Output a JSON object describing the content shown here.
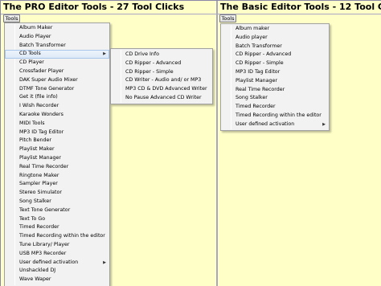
{
  "left": {
    "title": "The PRO Editor Tools - 27 Tool Clicks",
    "tools_label": "Tools",
    "menu": [
      {
        "label": "Album Maker"
      },
      {
        "label": "Audio Player"
      },
      {
        "label": "Batch Transformer"
      },
      {
        "label": "CD Tools",
        "submenu": true,
        "highlight": true
      },
      {
        "label": "CD Player"
      },
      {
        "label": "Crossfader Player"
      },
      {
        "label": "DAK Super Audio Mixer"
      },
      {
        "label": "DTMF Tone Generator"
      },
      {
        "label": "Get it (file info)"
      },
      {
        "label": "I Wish Recorder"
      },
      {
        "label": "Karaoke Wonders"
      },
      {
        "label": "MIDI Tools"
      },
      {
        "label": "MP3 ID Tag Editor"
      },
      {
        "label": "Pitch Bender"
      },
      {
        "label": "Playlist Maker"
      },
      {
        "label": "Playlist Manager"
      },
      {
        "label": "Real Time Recorder"
      },
      {
        "label": "Ringtone Maker"
      },
      {
        "label": "Sampler Player"
      },
      {
        "label": "Stereo Simulator"
      },
      {
        "label": "Song Stalker"
      },
      {
        "label": "Text Tone Generator"
      },
      {
        "label": "Text To Go"
      },
      {
        "label": "Timed Recorder"
      },
      {
        "label": "Timed Recording within the editor"
      },
      {
        "label": "Tune Library/ Player"
      },
      {
        "label": "USB MP3 Recorder"
      },
      {
        "label": "User defined activation",
        "submenu": true
      },
      {
        "label": "Unshackled DJ"
      },
      {
        "label": "Wave Waper"
      }
    ],
    "submenu": [
      {
        "label": "CD Drive Info"
      },
      {
        "label": "CD Ripper - Advanced"
      },
      {
        "label": "CD Ripper - Simple"
      },
      {
        "label": "CD Writer - Audio and/ or MP3"
      },
      {
        "label": "MP3 CD & DVD Advanced Writer"
      },
      {
        "label": "No Pause Advanced CD Writer"
      }
    ]
  },
  "right": {
    "title": "The Basic Editor Tools - 12 Tool Clicks",
    "tools_label": "Tools",
    "menu": [
      {
        "label": "Album maker"
      },
      {
        "label": "Audio player"
      },
      {
        "label": "Batch Transformer"
      },
      {
        "label": "CD Ripper - Advanced"
      },
      {
        "label": "CD Ripper - Simple"
      },
      {
        "label": "MP3 ID Tag Editor"
      },
      {
        "label": "Playlist Manager"
      },
      {
        "label": "Real Time Recorder"
      },
      {
        "label": "Song Stalker"
      },
      {
        "label": "Timed Recorder"
      },
      {
        "label": "Timed Recording within the editor"
      },
      {
        "label": "User defined activation",
        "submenu": true
      }
    ]
  },
  "icons": {
    "submenu_arrow": "triangle-right-icon"
  }
}
